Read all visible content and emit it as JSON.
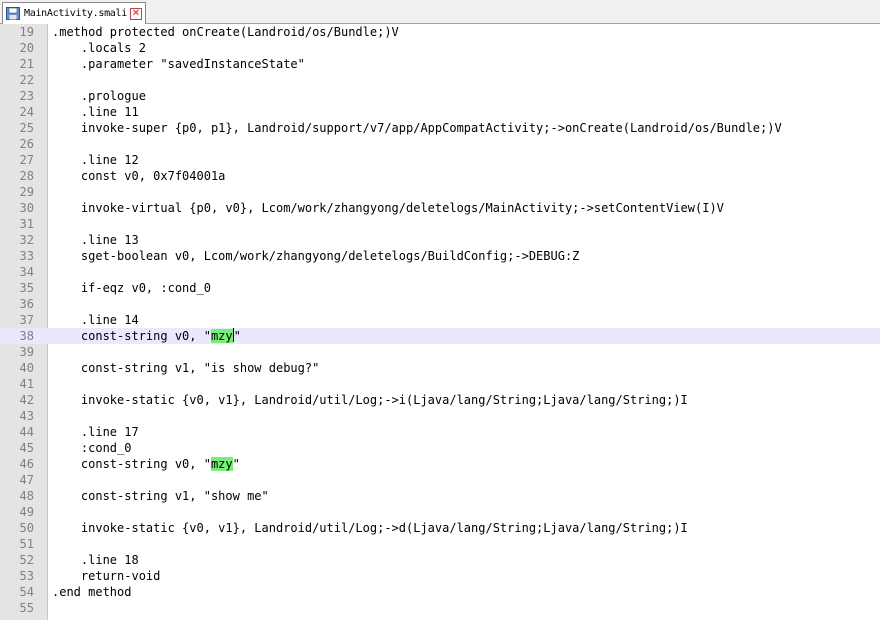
{
  "tab": {
    "label": "MainActivity.smali",
    "icon": "file-save-icon",
    "close_icon": "close-icon"
  },
  "editor": {
    "current_line": 38,
    "highlight_term": "mzy",
    "lines": [
      {
        "n": "19",
        "text": ".method protected onCreate(Landroid/os/Bundle;)V"
      },
      {
        "n": "20",
        "text": "    .locals 2"
      },
      {
        "n": "21",
        "text": "    .parameter \"savedInstanceState\""
      },
      {
        "n": "22",
        "text": ""
      },
      {
        "n": "23",
        "text": "    .prologue"
      },
      {
        "n": "24",
        "text": "    .line 11"
      },
      {
        "n": "25",
        "text": "    invoke-super {p0, p1}, Landroid/support/v7/app/AppCompatActivity;->onCreate(Landroid/os/Bundle;)V"
      },
      {
        "n": "26",
        "text": ""
      },
      {
        "n": "27",
        "text": "    .line 12"
      },
      {
        "n": "28",
        "text": "    const v0, 0x7f04001a"
      },
      {
        "n": "29",
        "text": ""
      },
      {
        "n": "30",
        "text": "    invoke-virtual {p0, v0}, Lcom/work/zhangyong/deletelogs/MainActivity;->setContentView(I)V"
      },
      {
        "n": "31",
        "text": ""
      },
      {
        "n": "32",
        "text": "    .line 13"
      },
      {
        "n": "33",
        "text": "    sget-boolean v0, Lcom/work/zhangyong/deletelogs/BuildConfig;->DEBUG:Z"
      },
      {
        "n": "34",
        "text": ""
      },
      {
        "n": "35",
        "text": "    if-eqz v0, :cond_0"
      },
      {
        "n": "36",
        "text": ""
      },
      {
        "n": "37",
        "text": "    .line 14"
      },
      {
        "n": "38",
        "pre": "    const-string v0, \"",
        "hl": "mzy",
        "post": "\"",
        "caret": true,
        "current": true
      },
      {
        "n": "39",
        "text": ""
      },
      {
        "n": "40",
        "text": "    const-string v1, \"is show debug?\""
      },
      {
        "n": "41",
        "text": ""
      },
      {
        "n": "42",
        "text": "    invoke-static {v0, v1}, Landroid/util/Log;->i(Ljava/lang/String;Ljava/lang/String;)I"
      },
      {
        "n": "43",
        "text": ""
      },
      {
        "n": "44",
        "text": "    .line 17"
      },
      {
        "n": "45",
        "text": "    :cond_0"
      },
      {
        "n": "46",
        "pre": "    const-string v0, \"",
        "hl": "mzy",
        "post": "\""
      },
      {
        "n": "47",
        "text": ""
      },
      {
        "n": "48",
        "text": "    const-string v1, \"show me\""
      },
      {
        "n": "49",
        "text": ""
      },
      {
        "n": "50",
        "text": "    invoke-static {v0, v1}, Landroid/util/Log;->d(Ljava/lang/String;Ljava/lang/String;)I"
      },
      {
        "n": "51",
        "text": ""
      },
      {
        "n": "52",
        "text": "    .line 18"
      },
      {
        "n": "53",
        "text": "    return-void"
      },
      {
        "n": "54",
        "text": ".end method"
      },
      {
        "n": "55",
        "text": ""
      }
    ]
  }
}
